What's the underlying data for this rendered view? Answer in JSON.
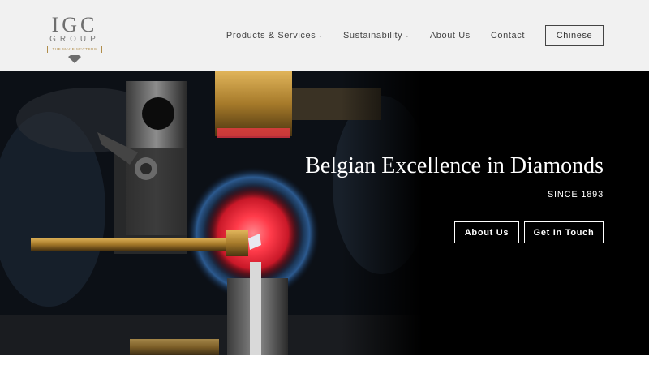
{
  "logo": {
    "main": "IGC",
    "sub": "GROUP",
    "tagline": "THE MAKE MATTERS",
    "mark": "diamond-icon"
  },
  "nav": {
    "items": [
      {
        "label": "Products & Services",
        "has_dropdown": true
      },
      {
        "label": "Sustainability",
        "has_dropdown": true
      },
      {
        "label": "About Us",
        "has_dropdown": false
      },
      {
        "label": "Contact",
        "has_dropdown": false
      }
    ],
    "language_button": "Chinese",
    "caret_glyph": "⌄"
  },
  "hero": {
    "title": "Belgian Excellence in Diamonds",
    "subtitle": "SINCE 1893",
    "buttons": {
      "about": "About Us",
      "touch": "Get In Touch"
    }
  },
  "colors": {
    "header_bg": "#f1f1f1",
    "hero_bg": "#050505",
    "accent_gold": "#b08d4a",
    "glow_red": "#ff3b4a"
  }
}
